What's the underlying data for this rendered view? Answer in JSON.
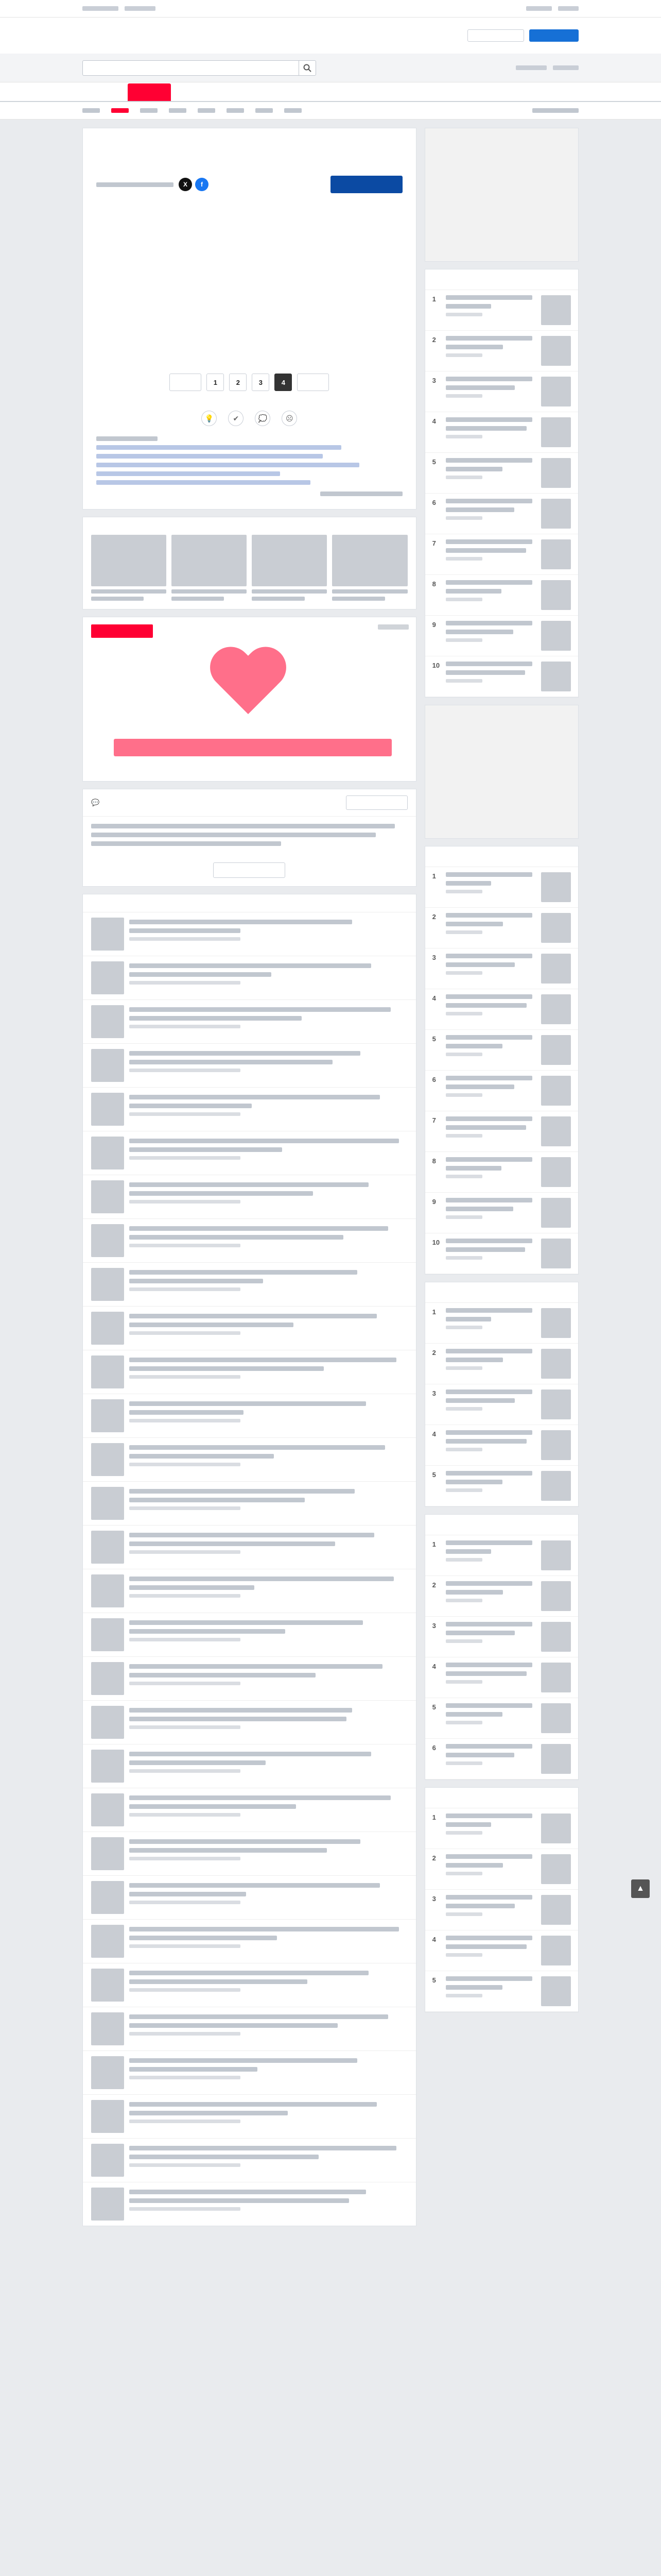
{
  "brand": {
    "logo": "",
    "section": ""
  },
  "top_links": [
    "",
    "",
    "",
    ""
  ],
  "header": {
    "login_label": "",
    "signup_label": ""
  },
  "search": {
    "placeholder": "",
    "button_icon": "search-icon",
    "right_links": [
      "",
      ""
    ]
  },
  "nav_tabs": [
    "",
    "",
    "",
    "",
    "",
    "",
    "",
    "",
    "",
    "",
    ""
  ],
  "subnav": [
    "",
    "",
    "",
    "",
    "",
    "",
    "",
    "",
    ""
  ],
  "article": {
    "title": "",
    "meta": "",
    "provider": "",
    "sections": [
      {
        "heading": "",
        "body": ""
      },
      {
        "heading": "",
        "body": ""
      },
      {
        "heading": "",
        "body": ""
      }
    ],
    "source_note": "",
    "pager": {
      "prev": "",
      "pages": [
        "1",
        "2",
        "3",
        "4"
      ],
      "current": "4",
      "next": "",
      "caption": ""
    },
    "related_heading": "",
    "related": [
      "",
      "",
      "",
      "",
      ""
    ],
    "credit": ""
  },
  "more_articles": {
    "heading": "",
    "items": [
      "",
      "",
      "",
      ""
    ]
  },
  "ad": {
    "brand": "",
    "tag": "",
    "copy": ""
  },
  "comments": {
    "count": "",
    "post_label": "",
    "body": "",
    "more_label": ""
  },
  "recommended": {
    "heading": "",
    "items": [
      "",
      "",
      "",
      "",
      "",
      "",
      "",
      "",
      "",
      "",
      "",
      "",
      "",
      "",
      "",
      "",
      "",
      "",
      "",
      "",
      "",
      "",
      "",
      "",
      "",
      "",
      "",
      "",
      "",
      ""
    ]
  },
  "sidebar": {
    "access_ranking": {
      "heading": "",
      "items": [
        "",
        "",
        "",
        "",
        "",
        "",
        "",
        "",
        "",
        ""
      ]
    },
    "comment_ranking": {
      "heading": "",
      "items": [
        "",
        "",
        "",
        "",
        "",
        "",
        "",
        "",
        "",
        ""
      ]
    },
    "new_ranking": {
      "heading": "",
      "items": [
        "",
        "",
        "",
        "",
        ""
      ]
    },
    "shopping": {
      "heading": "",
      "items": [
        "",
        "",
        "",
        "",
        "",
        ""
      ]
    },
    "reactions": {
      "heading": "",
      "items": [
        "",
        "",
        "",
        "",
        ""
      ]
    }
  },
  "colors": {
    "brand_red": "#ff0033",
    "link_blue": "#1450b4",
    "provider_blue": "#0b4aa3",
    "ad_pink": "#ff6f8a"
  }
}
